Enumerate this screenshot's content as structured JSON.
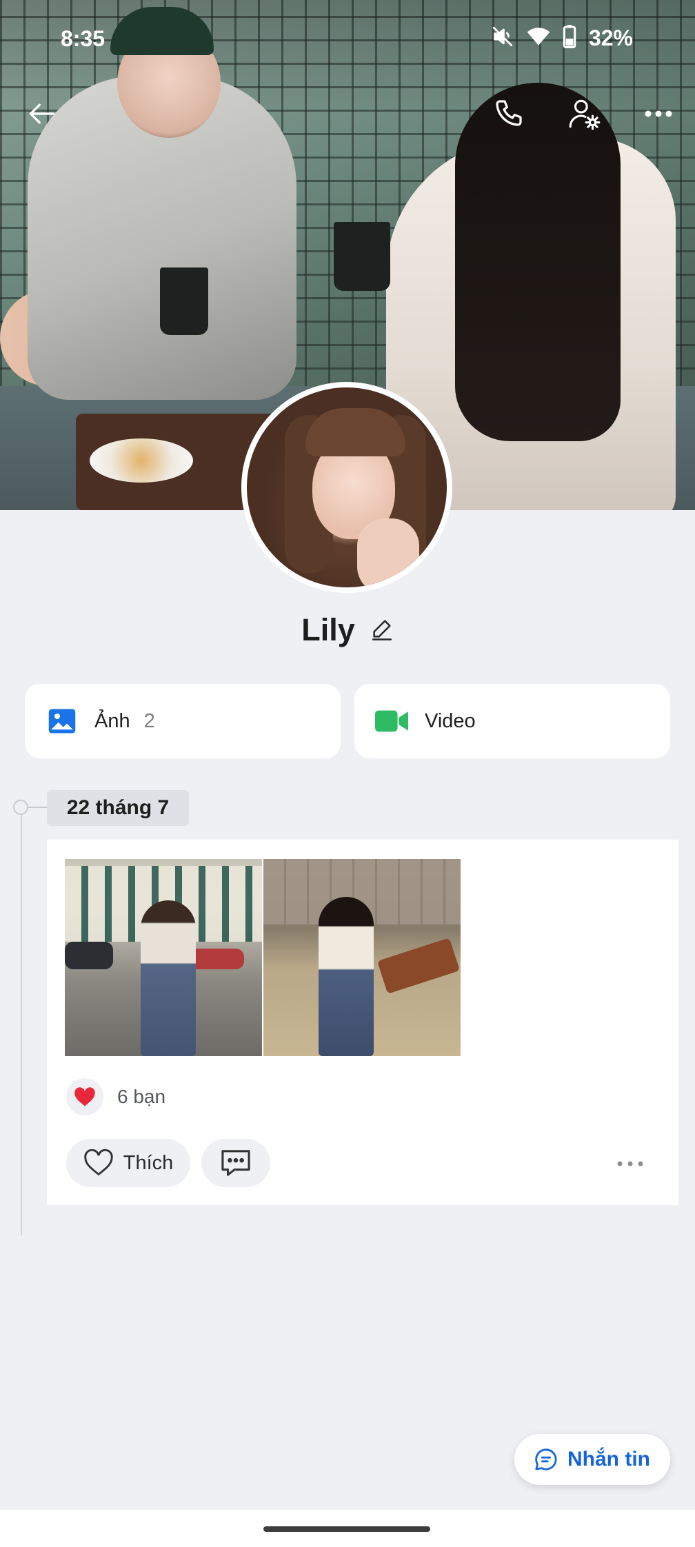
{
  "status_bar": {
    "time": "8:35",
    "battery": "32%"
  },
  "topbar": {
    "back_icon": "arrow-left-icon",
    "call_icon": "phone-icon",
    "settings_icon": "user-settings-icon",
    "more_icon": "more-horizontal-icon"
  },
  "profile": {
    "name": "Lily",
    "edit_icon": "pencil-icon"
  },
  "media": {
    "photos_label": "Ảnh",
    "photos_count": "2",
    "video_label": "Video"
  },
  "timeline": {
    "date": "22 tháng 7",
    "post": {
      "reaction_count": "6 bạn",
      "like_label": "Thích"
    }
  },
  "message_button": {
    "label": "Nhắn tin"
  },
  "colors": {
    "accent": "#1565d8",
    "photos_icon": "#1a73e8",
    "video_icon": "#2fba64",
    "heart": "#e8283a",
    "background": "#eff0f4"
  }
}
